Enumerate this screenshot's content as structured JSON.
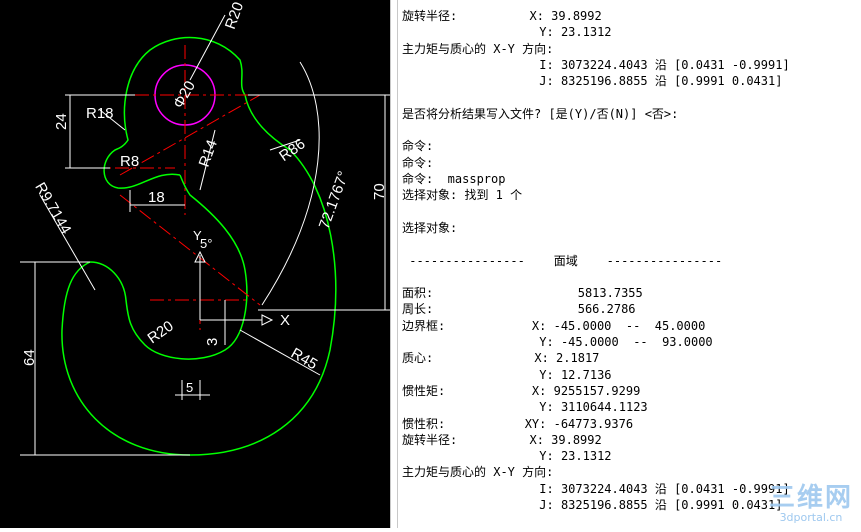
{
  "colors": {
    "background_drawing": "#000000",
    "outline": "#00ff00",
    "center_lines": "#ff0000",
    "dimension": "#ffffff",
    "inner_circle": "#ff00ff"
  },
  "drawing": {
    "labels": {
      "r20_top": "R20",
      "phi20": "Φ20",
      "r18": "R18",
      "r8": "R8",
      "r14": "R14",
      "r86": "R86",
      "dim24": "24",
      "dim18": "18",
      "dim70": "70",
      "angle": "72.1767°",
      "r97144": "R9.7144",
      "angle5": "5°",
      "y_axis": "Y",
      "x_axis": "X",
      "r20_bottom": "R20",
      "dim3": "3",
      "dim64": "64",
      "dim5": "5",
      "r45": "R45"
    }
  },
  "command_lines": [
    "旋转半径:          X: 39.8992",
    "                   Y: 23.1312",
    "主力矩与质心的 X-Y 方向:",
    "                   I: 3073224.4043 沿 [0.0431 -0.9991]",
    "                   J: 8325196.8855 沿 [0.9991 0.0431]",
    "",
    "是否将分析结果写入文件? [是(Y)/否(N)] <否>:",
    "",
    "命令:",
    "命令:",
    "命令:  massprop",
    "选择对象: 找到 1 个",
    "",
    "选择对象:",
    "",
    " ----------------    面域    ----------------",
    "",
    "面积:                    5813.7355",
    "周长:                    566.2786",
    "边界框:            X: -45.0000  --  45.0000",
    "                   Y: -45.0000  --  93.0000",
    "质心:              X: 2.1817",
    "                   Y: 12.7136",
    "惯性矩:            X: 9255157.9299",
    "                   Y: 3110644.1123",
    "惯性积:           XY: -64773.9376",
    "旋转半径:          X: 39.8992",
    "                   Y: 23.1312",
    "主力矩与质心的 X-Y 方向:",
    "                   I: 3073224.4043 沿 [0.0431 -0.9991]",
    "                   J: 8325196.8855 沿 [0.9991 0.0431]"
  ],
  "watermark": {
    "main": "三维网",
    "sub": "3dportal.cn"
  }
}
